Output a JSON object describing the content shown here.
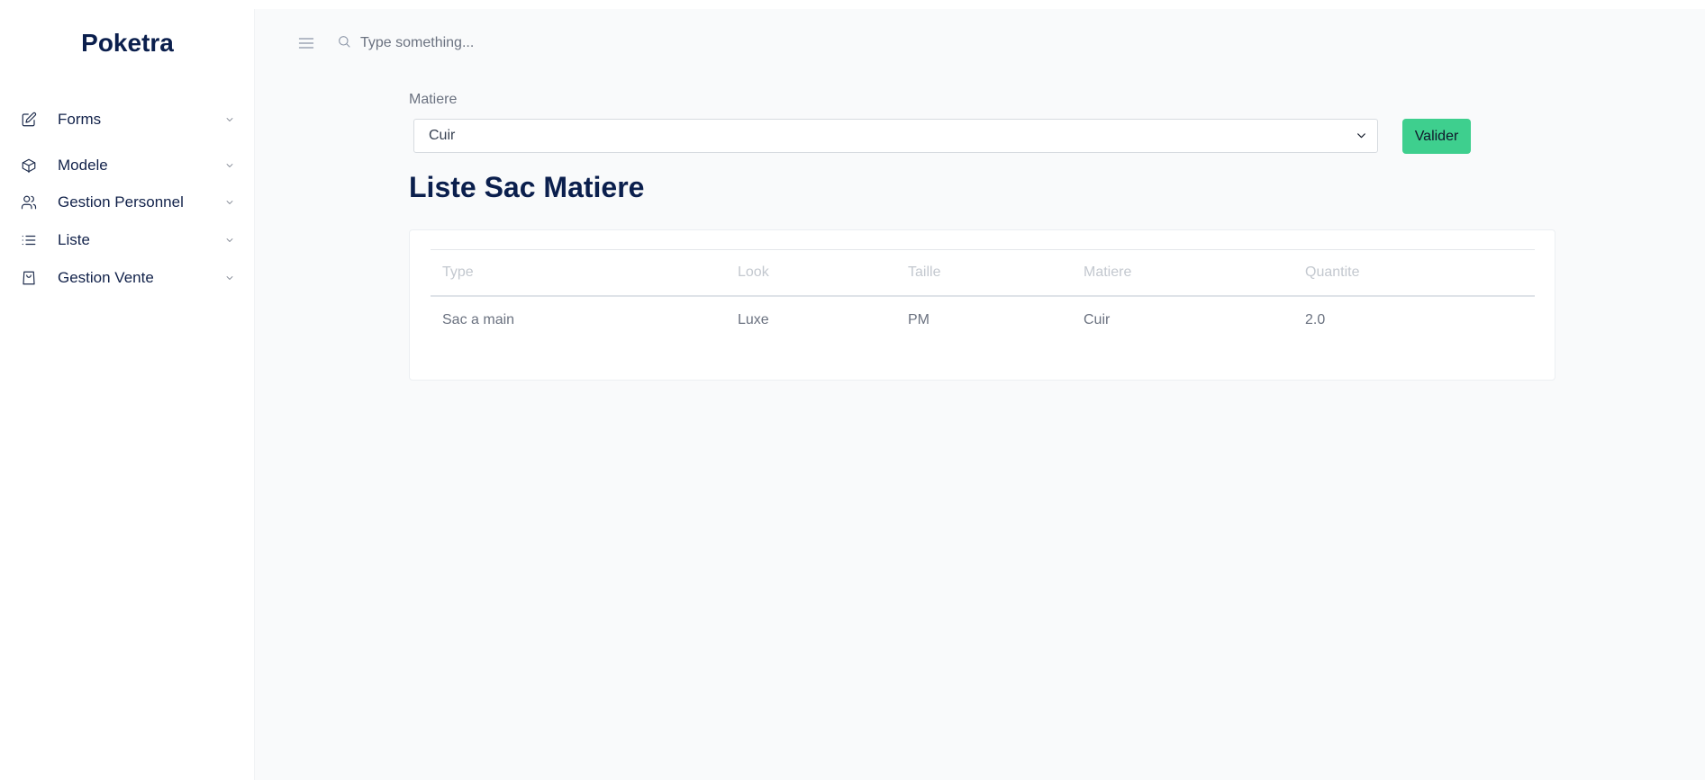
{
  "brand": "Poketra",
  "sidebar": {
    "items": [
      {
        "label": "Forms",
        "icon": "edit-icon"
      },
      {
        "label": "Modele",
        "icon": "cube-icon"
      },
      {
        "label": "Gestion Personnel",
        "icon": "users-icon"
      },
      {
        "label": "Liste",
        "icon": "list-icon"
      },
      {
        "label": "Gestion Vente",
        "icon": "shopping-bag-icon"
      }
    ]
  },
  "topbar": {
    "menu_icon": "menu-icon",
    "search_icon": "search-icon",
    "search_placeholder": "Type something..."
  },
  "form": {
    "label": "Matiere",
    "selected": "Cuir",
    "submit_label": "Valider"
  },
  "page": {
    "title": "Liste Sac Matiere"
  },
  "table": {
    "headers": [
      "Type",
      "Look",
      "Taille",
      "Matiere",
      "Quantite"
    ],
    "rows": [
      [
        "Sac a main",
        "Luxe",
        "PM",
        "Cuir",
        "2.0"
      ]
    ]
  },
  "colors": {
    "brand": "#0b1f4d",
    "accent_button": "#3ecf8e",
    "background": "#f9fafb"
  }
}
